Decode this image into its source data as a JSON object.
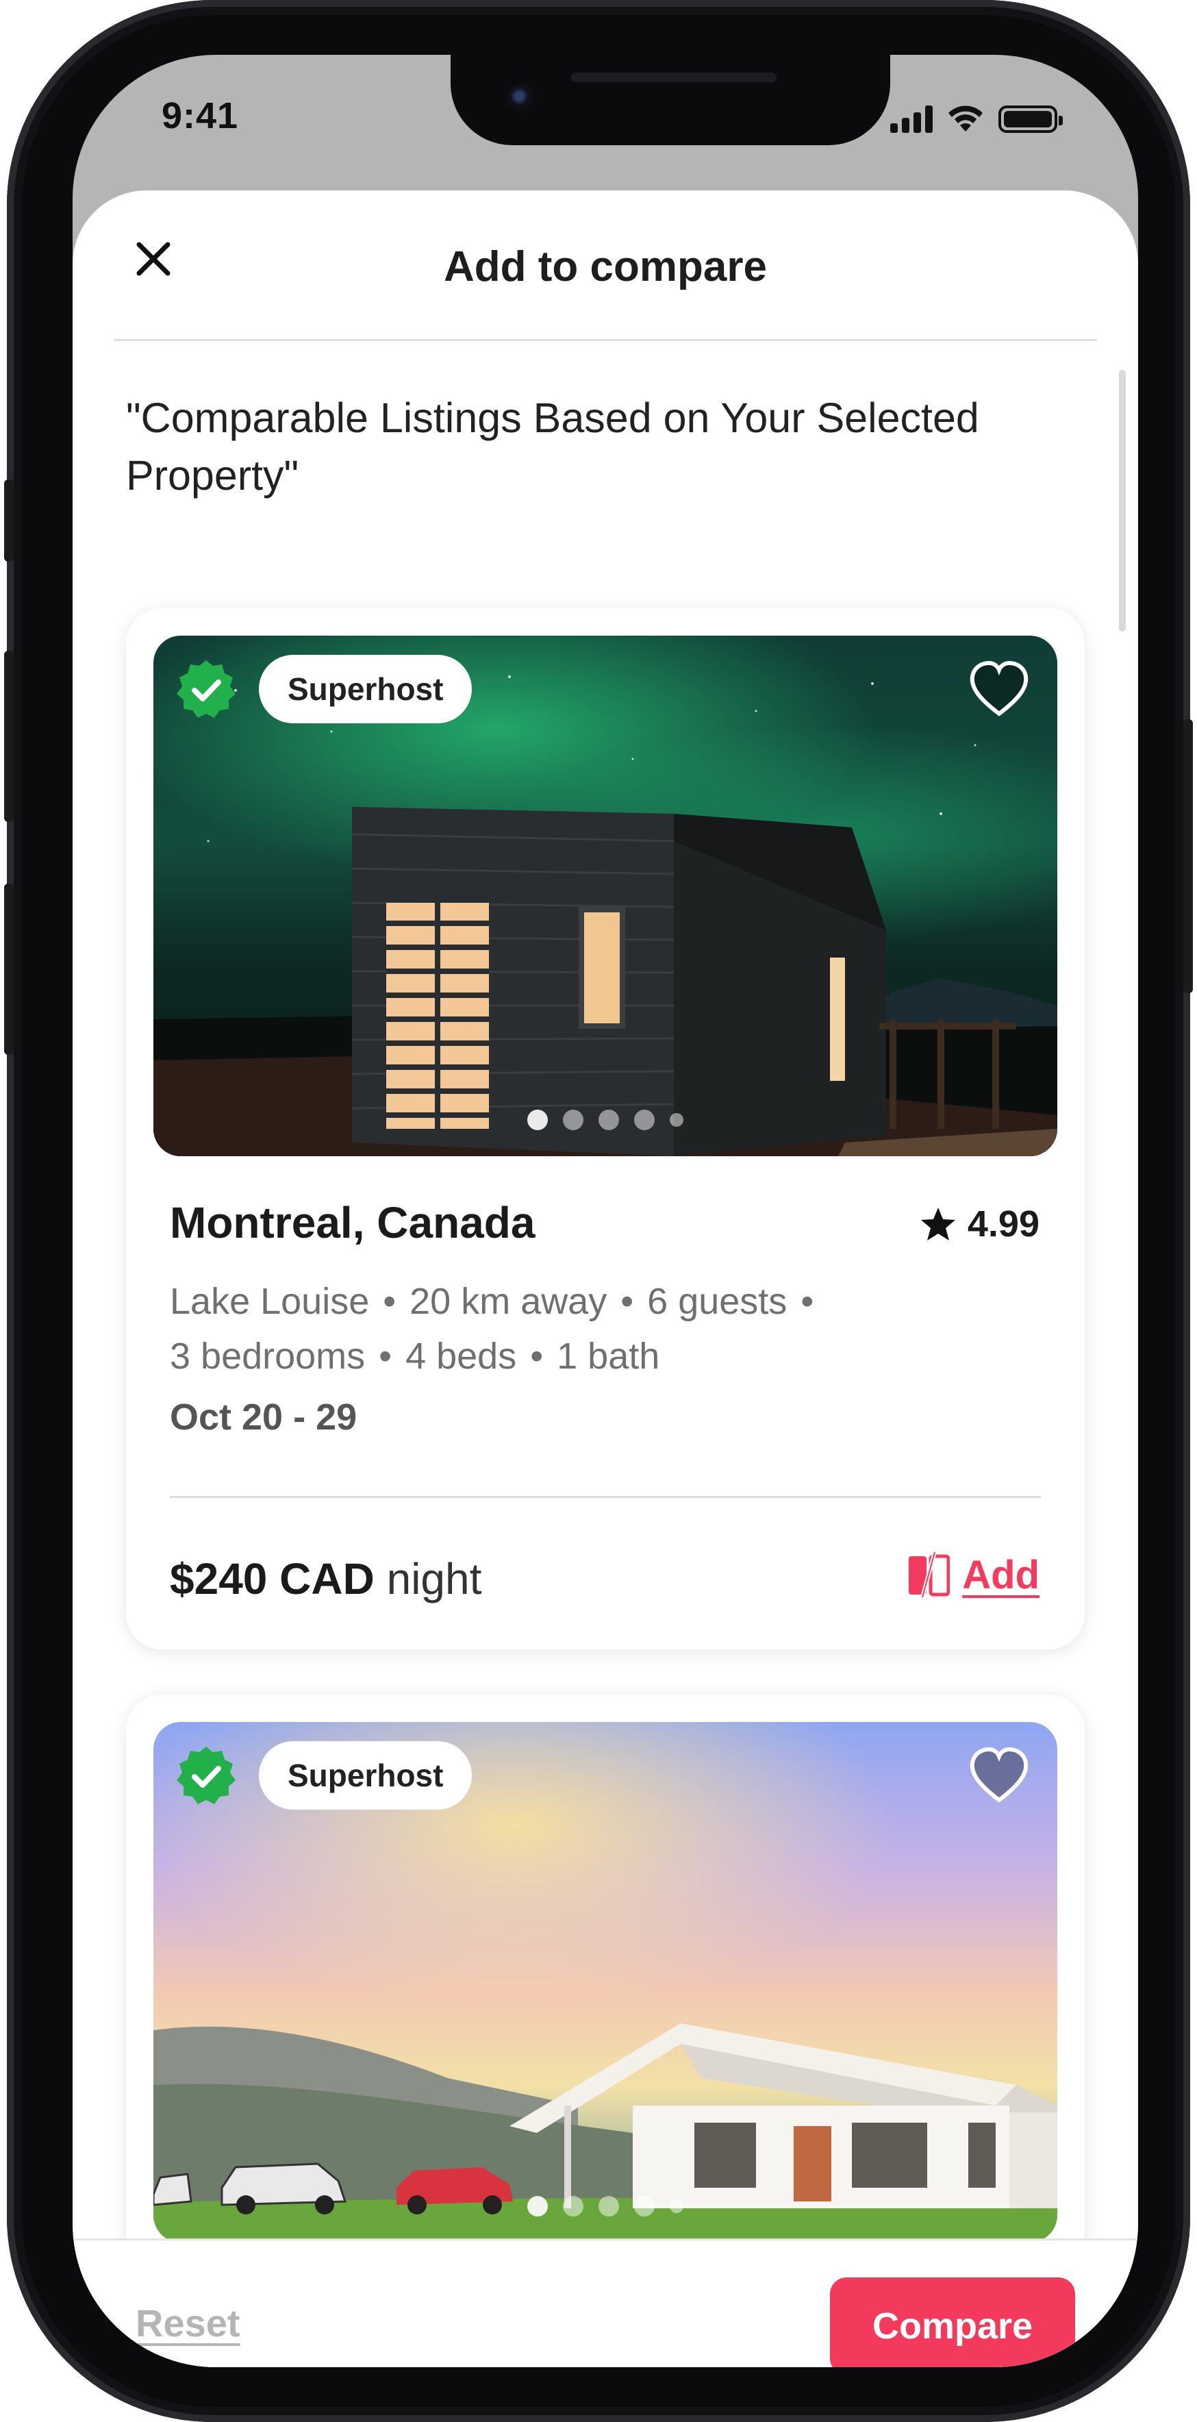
{
  "status_bar": {
    "time": "9:41"
  },
  "sheet": {
    "title": "Add to compare",
    "intro": "\"Comparable Listings Based on Your Selected Property\""
  },
  "listings": [
    {
      "badge": "Superhost",
      "title": "Montreal, Canada",
      "rating": "4.99",
      "details": [
        "Lake Louise",
        "20 km away",
        "6 guests",
        "3 bedrooms",
        "4 beds",
        "1 bath"
      ],
      "dates": "Oct 20 - 29",
      "price": "$240 CAD",
      "price_unit": "night",
      "add_label": "Add"
    },
    {
      "badge": "Superhost"
    }
  ],
  "footer": {
    "reset_label": "Reset",
    "compare_label": "Compare"
  },
  "colors": {
    "accent": "#f43a5c",
    "superhost_check": "#22b04a",
    "text_primary": "#1b1b1b",
    "text_secondary": "#6f6f6f"
  },
  "icons": [
    "close-icon",
    "verified-check-icon",
    "heart-icon",
    "star-icon",
    "compare-icon"
  ]
}
